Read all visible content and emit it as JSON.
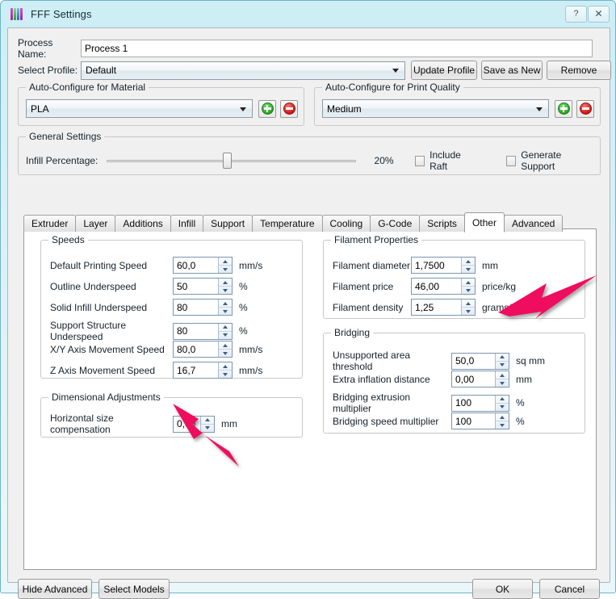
{
  "window": {
    "title": "FFF Settings",
    "icon": "fff-bars-icon",
    "help_button": "?",
    "close_button": "✕"
  },
  "top": {
    "process_name_label": "Process Name:",
    "process_name_value": "Process 1",
    "select_profile_label": "Select Profile:",
    "select_profile_value": "Default",
    "update_profile": "Update Profile",
    "save_as_new": "Save as New",
    "remove": "Remove"
  },
  "material_group": {
    "title": "Auto-Configure for Material",
    "value": "PLA",
    "add_label": "+",
    "remove_label": "−"
  },
  "quality_group": {
    "title": "Auto-Configure for Print Quality",
    "value": "Medium",
    "add_label": "+",
    "remove_label": "−"
  },
  "general_group": {
    "title": "General Settings",
    "infill_label": "Infill Percentage:",
    "infill_value": "20%",
    "infill_percent": 20,
    "include_raft": "Include Raft",
    "include_raft_checked": false,
    "generate_support": "Generate Support",
    "generate_support_checked": false
  },
  "tabs": [
    {
      "label": "Extruder",
      "active": false
    },
    {
      "label": "Layer",
      "active": false
    },
    {
      "label": "Additions",
      "active": false
    },
    {
      "label": "Infill",
      "active": false
    },
    {
      "label": "Support",
      "active": false
    },
    {
      "label": "Temperature",
      "active": false
    },
    {
      "label": "Cooling",
      "active": false
    },
    {
      "label": "G-Code",
      "active": false
    },
    {
      "label": "Scripts",
      "active": false
    },
    {
      "label": "Other",
      "active": true
    },
    {
      "label": "Advanced",
      "active": false
    }
  ],
  "speeds": {
    "title": "Speeds",
    "rows": [
      {
        "label": "Default Printing Speed",
        "value": "60,0",
        "unit": "mm/s"
      },
      {
        "label": "Outline Underspeed",
        "value": "50",
        "unit": "%"
      },
      {
        "label": "Solid Infill Underspeed",
        "value": "80",
        "unit": "%"
      },
      {
        "label": "Support Structure Underspeed",
        "value": "80",
        "unit": "%"
      },
      {
        "label": "X/Y Axis Movement Speed",
        "value": "80,0",
        "unit": "mm/s"
      },
      {
        "label": "Z Axis Movement Speed",
        "value": "16,7",
        "unit": "mm/s"
      }
    ]
  },
  "dimensional": {
    "title": "Dimensional Adjustments",
    "rows": [
      {
        "label": "Horizontal size compensation",
        "value": "0,00",
        "unit": "mm"
      }
    ]
  },
  "filament": {
    "title": "Filament Properties",
    "rows": [
      {
        "label": "Filament diameter",
        "value": "1,7500",
        "unit": "mm"
      },
      {
        "label": "Filament price",
        "value": "46,00",
        "unit": "price/kg"
      },
      {
        "label": "Filament density",
        "value": "1,25",
        "unit": "grams/cm^3"
      }
    ]
  },
  "bridging": {
    "title": "Bridging",
    "rows": [
      {
        "label": "Unsupported area threshold",
        "value": "50,0",
        "unit": "sq mm"
      },
      {
        "label": "Extra inflation distance",
        "value": "0,00",
        "unit": "mm"
      },
      {
        "label": "Bridging extrusion multiplier",
        "value": "100",
        "unit": "%"
      },
      {
        "label": "Bridging speed multiplier",
        "value": "100",
        "unit": "%"
      }
    ]
  },
  "footer": {
    "hide_advanced": "Hide Advanced",
    "select_models": "Select Models",
    "ok": "OK",
    "cancel": "Cancel"
  },
  "annotations": {
    "arrow_color": "#ee0e5e",
    "arrow_1_target": "bridging-group",
    "arrow_2_target": "horizontal-size-compensation-field"
  }
}
